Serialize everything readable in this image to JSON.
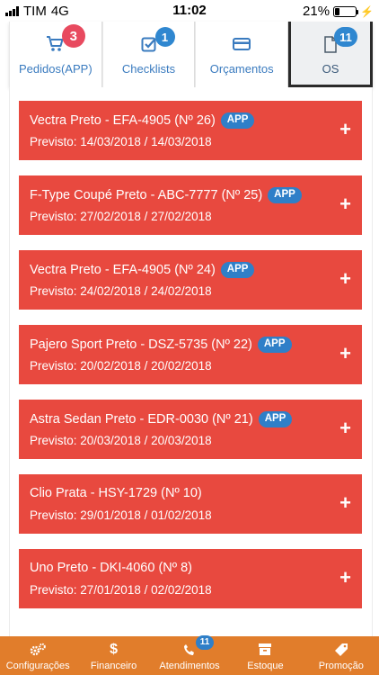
{
  "status_bar": {
    "carrier": "TIM",
    "network": "4G",
    "time": "11:02",
    "battery_percent": "21%",
    "battery_level": 0.21
  },
  "tabs": [
    {
      "label": "Pedidos(APP)",
      "badge": "3",
      "icon": "cart-icon",
      "badge_color": "#e84a5f"
    },
    {
      "label": "Checklists",
      "badge": "1",
      "icon": "checklist-icon",
      "badge_color": "#2f87d0"
    },
    {
      "label": "Orçamentos",
      "badge": "",
      "icon": "card-icon"
    },
    {
      "label": "OS",
      "badge": "11",
      "icon": "document-icon",
      "badge_color": "#2f87d0",
      "active": true
    }
  ],
  "orders": [
    {
      "title": "Vectra Preto - EFA-4905 (Nº 26)",
      "app": "APP",
      "previsto": "Previsto: 14/03/2018 / 14/03/2018"
    },
    {
      "title": "F-Type Coupé Preto - ABC-7777 (Nº 25)",
      "app": "APP",
      "previsto": "Previsto: 27/02/2018 / 27/02/2018"
    },
    {
      "title": "Vectra Preto - EFA-4905 (Nº 24)",
      "app": "APP",
      "previsto": "Previsto: 24/02/2018 / 24/02/2018"
    },
    {
      "title": "Pajero Sport Preto - DSZ-5735 (Nº 22)",
      "app": "APP",
      "previsto": "Previsto: 20/02/2018 / 20/02/2018"
    },
    {
      "title": "Astra Sedan Preto - EDR-0030 (Nº 21)",
      "app": "APP",
      "previsto": "Previsto: 20/03/2018 / 20/03/2018"
    },
    {
      "title": "Clio Prata - HSY-1729 (Nº 10)",
      "app": "",
      "previsto": "Previsto: 29/01/2018 / 01/02/2018"
    },
    {
      "title": "Uno Preto - DKI-4060 (Nº 8)",
      "app": "",
      "previsto": "Previsto: 27/01/2018 / 02/02/2018"
    }
  ],
  "expand_symbol": "+",
  "bottom_nav": [
    {
      "label": "Configurações",
      "icon": "gears-icon",
      "badge": ""
    },
    {
      "label": "Financeiro",
      "icon": "dollar-icon",
      "symbol": "$",
      "badge": ""
    },
    {
      "label": "Atendimentos",
      "icon": "phone-icon",
      "badge": "11"
    },
    {
      "label": "Estoque",
      "icon": "box-icon",
      "badge": ""
    },
    {
      "label": "Promoção",
      "icon": "tag-icon",
      "badge": ""
    }
  ],
  "colors": {
    "card": "#e8493f",
    "app_badge": "#2f7fc8",
    "nav": "#e17d2b",
    "tab_label": "#3a7bbf"
  }
}
